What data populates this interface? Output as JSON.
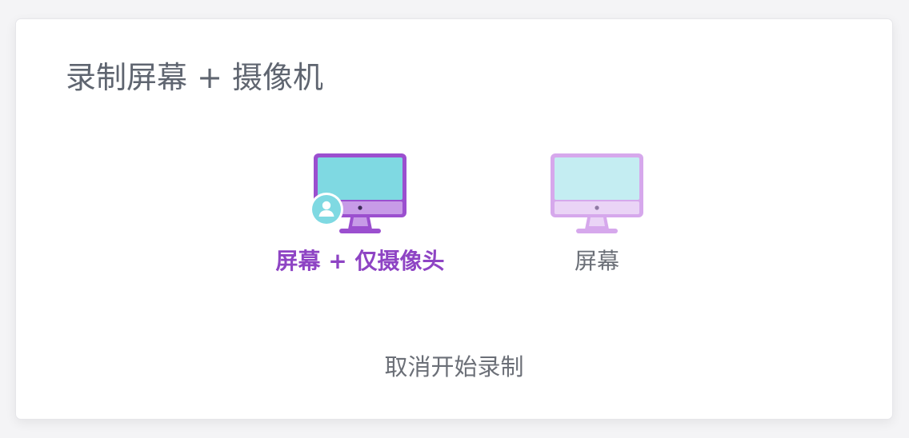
{
  "dialog": {
    "title": "录制屏幕 + 摄像机",
    "options": [
      {
        "label": "屏幕 + 仅摄像头",
        "icon": "monitor-with-camera-icon",
        "selected": true
      },
      {
        "label": "屏幕",
        "icon": "monitor-icon",
        "selected": false
      }
    ],
    "cancel_label": "取消开始录制"
  },
  "colors": {
    "accent": "#8e44c4",
    "monitor_frame_active": "#9b4fcf",
    "monitor_screen_active": "#7fd9e2",
    "monitor_chin_active": "#c79be7",
    "monitor_frame_inactive": "#d6a8ec",
    "monitor_screen_inactive": "#c4edf2",
    "monitor_chin_inactive": "#ead4f6",
    "avatar_bg": "#7fd9e2",
    "text_gray": "#6b6f77",
    "title_gray": "#5f6570"
  }
}
